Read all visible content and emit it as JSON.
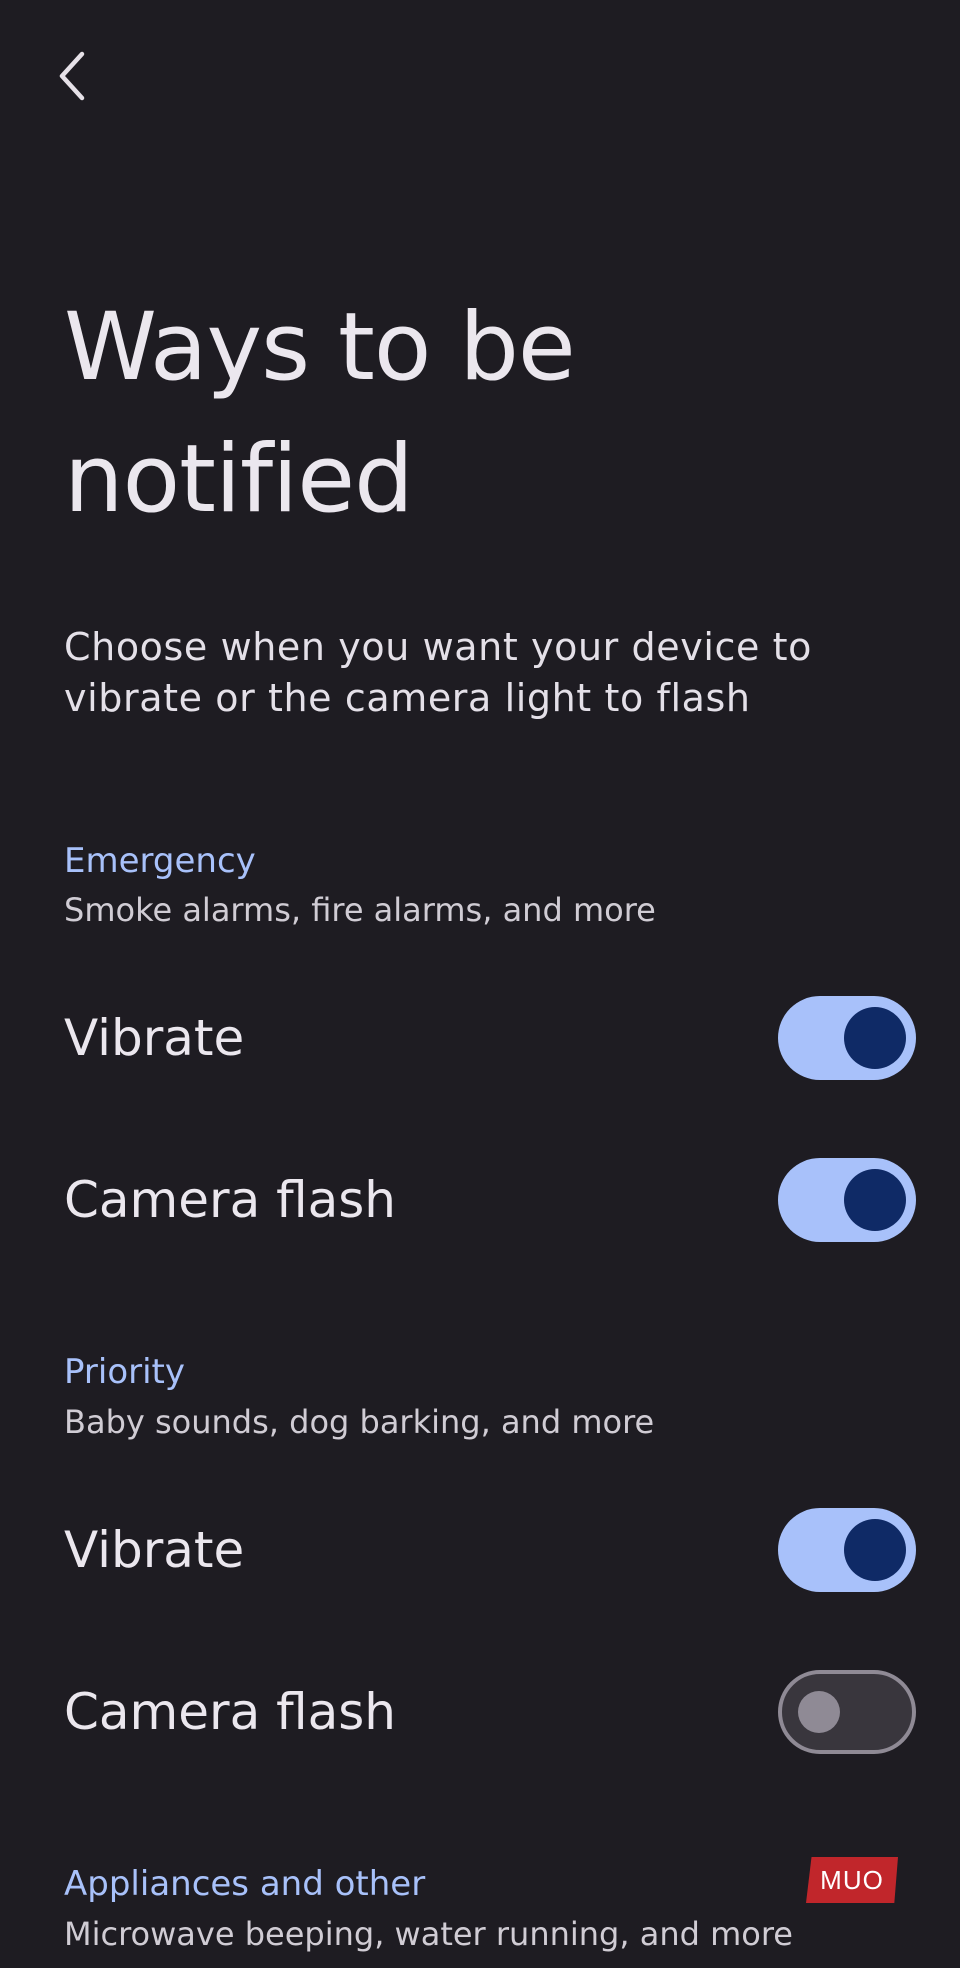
{
  "header": {
    "title": "Ways to be notified",
    "description": "Choose when you want your device to vibrate or the camera light to flash"
  },
  "sections": [
    {
      "title": "Emergency",
      "subtitle": "Smoke alarms, fire alarms, and more",
      "settings": [
        {
          "label": "Vibrate",
          "enabled": true
        },
        {
          "label": "Camera flash",
          "enabled": true
        }
      ]
    },
    {
      "title": "Priority",
      "subtitle": "Baby sounds, dog barking, and more",
      "settings": [
        {
          "label": "Vibrate",
          "enabled": true
        },
        {
          "label": "Camera flash",
          "enabled": false
        }
      ]
    },
    {
      "title": "Appliances and other",
      "subtitle": "Microwave beeping, water running, and more"
    }
  ],
  "icons": {
    "back": "back-arrow-icon"
  },
  "watermark": {
    "text": "MUO"
  },
  "colors": {
    "background": "#1e1c22",
    "accent": "#a8c1fa",
    "switch_thumb_on": "#0f2a66",
    "switch_off": "#8f8a95",
    "watermark": "#c1262b"
  }
}
